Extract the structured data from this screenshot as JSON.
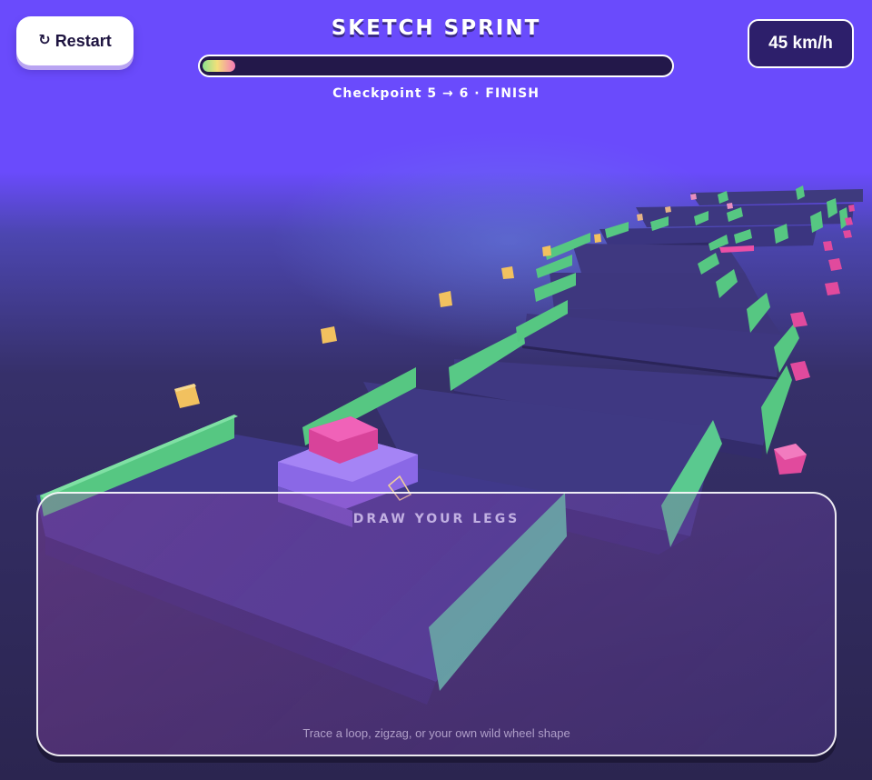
{
  "hud": {
    "restart_icon": "↻",
    "restart_label": "Restart",
    "title": "SKETCH SPRINT",
    "progress_fraction": 0.07,
    "checkpoint_text": "Checkpoint 5 → 6 · FINISH",
    "speed_text": "45 km/h"
  },
  "draw_panel": {
    "title": "DRAW YOUR LEGS",
    "hint": "Trace a loop, zigzag, or your own wild wheel shape"
  },
  "colors": {
    "sky": "#6a4bfc",
    "track": "#3e3679",
    "rail": "#5fd58e",
    "player_body": "#9673ee",
    "player_top": "#f05cb3",
    "coin": "#f2c15f",
    "pink_cube": "#ec4fa6"
  }
}
